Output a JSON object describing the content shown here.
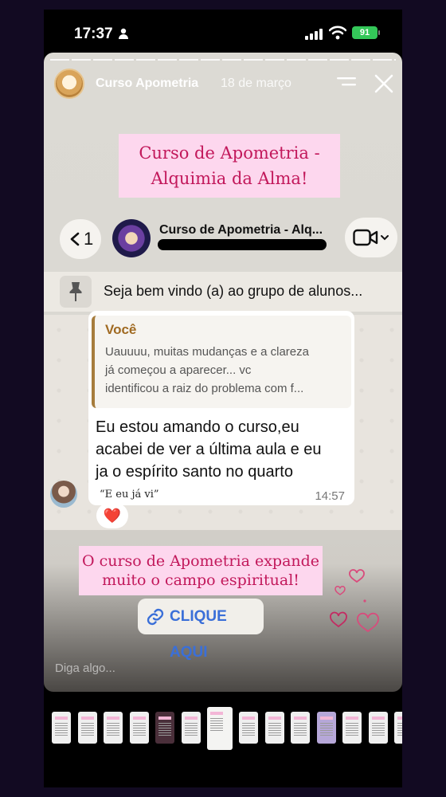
{
  "status_bar": {
    "time": "17:37",
    "battery": "91",
    "icons": [
      "person-icon",
      "signal-icon",
      "wifi-icon",
      "battery-icon"
    ]
  },
  "story": {
    "account_name": "Curso Apometria",
    "date": "18 de março",
    "title_line1": "Curso de Apometria -",
    "title_line2": "Alquimia da Alma!",
    "promo_line1": "O curso de Apometria expande",
    "promo_line2": "muito o campo espiritual!",
    "link_label": "CLIQUE AQUI",
    "reply_placeholder": "Diga algo...",
    "colors": {
      "pink_box": "#fdd7ee",
      "pink_text": "#c2185b",
      "link_blue": "#3a6fd8"
    }
  },
  "chat": {
    "back_count": "1",
    "group_name": "Curso de Apometria - Alq...",
    "pinned_message": "Seja bem vindo (a) ao grupo de alunos...",
    "quote_author": "Você",
    "quote_line1": "Uauuuu, muitas mudanças e a clareza",
    "quote_line2": "já começou a aparecer... vc",
    "quote_line3": "identificou a raiz do problema com f...",
    "message_line1": "Eu estou amando o curso,eu",
    "message_line2": "acabei de ver a última aula e eu",
    "message_line3": "ja o espírito santo no quarto",
    "sticker_note": "“E eu já vi”",
    "time": "14:57",
    "reaction": "❤️"
  },
  "thumbnail_count": 15,
  "active_thumbnail": 6
}
